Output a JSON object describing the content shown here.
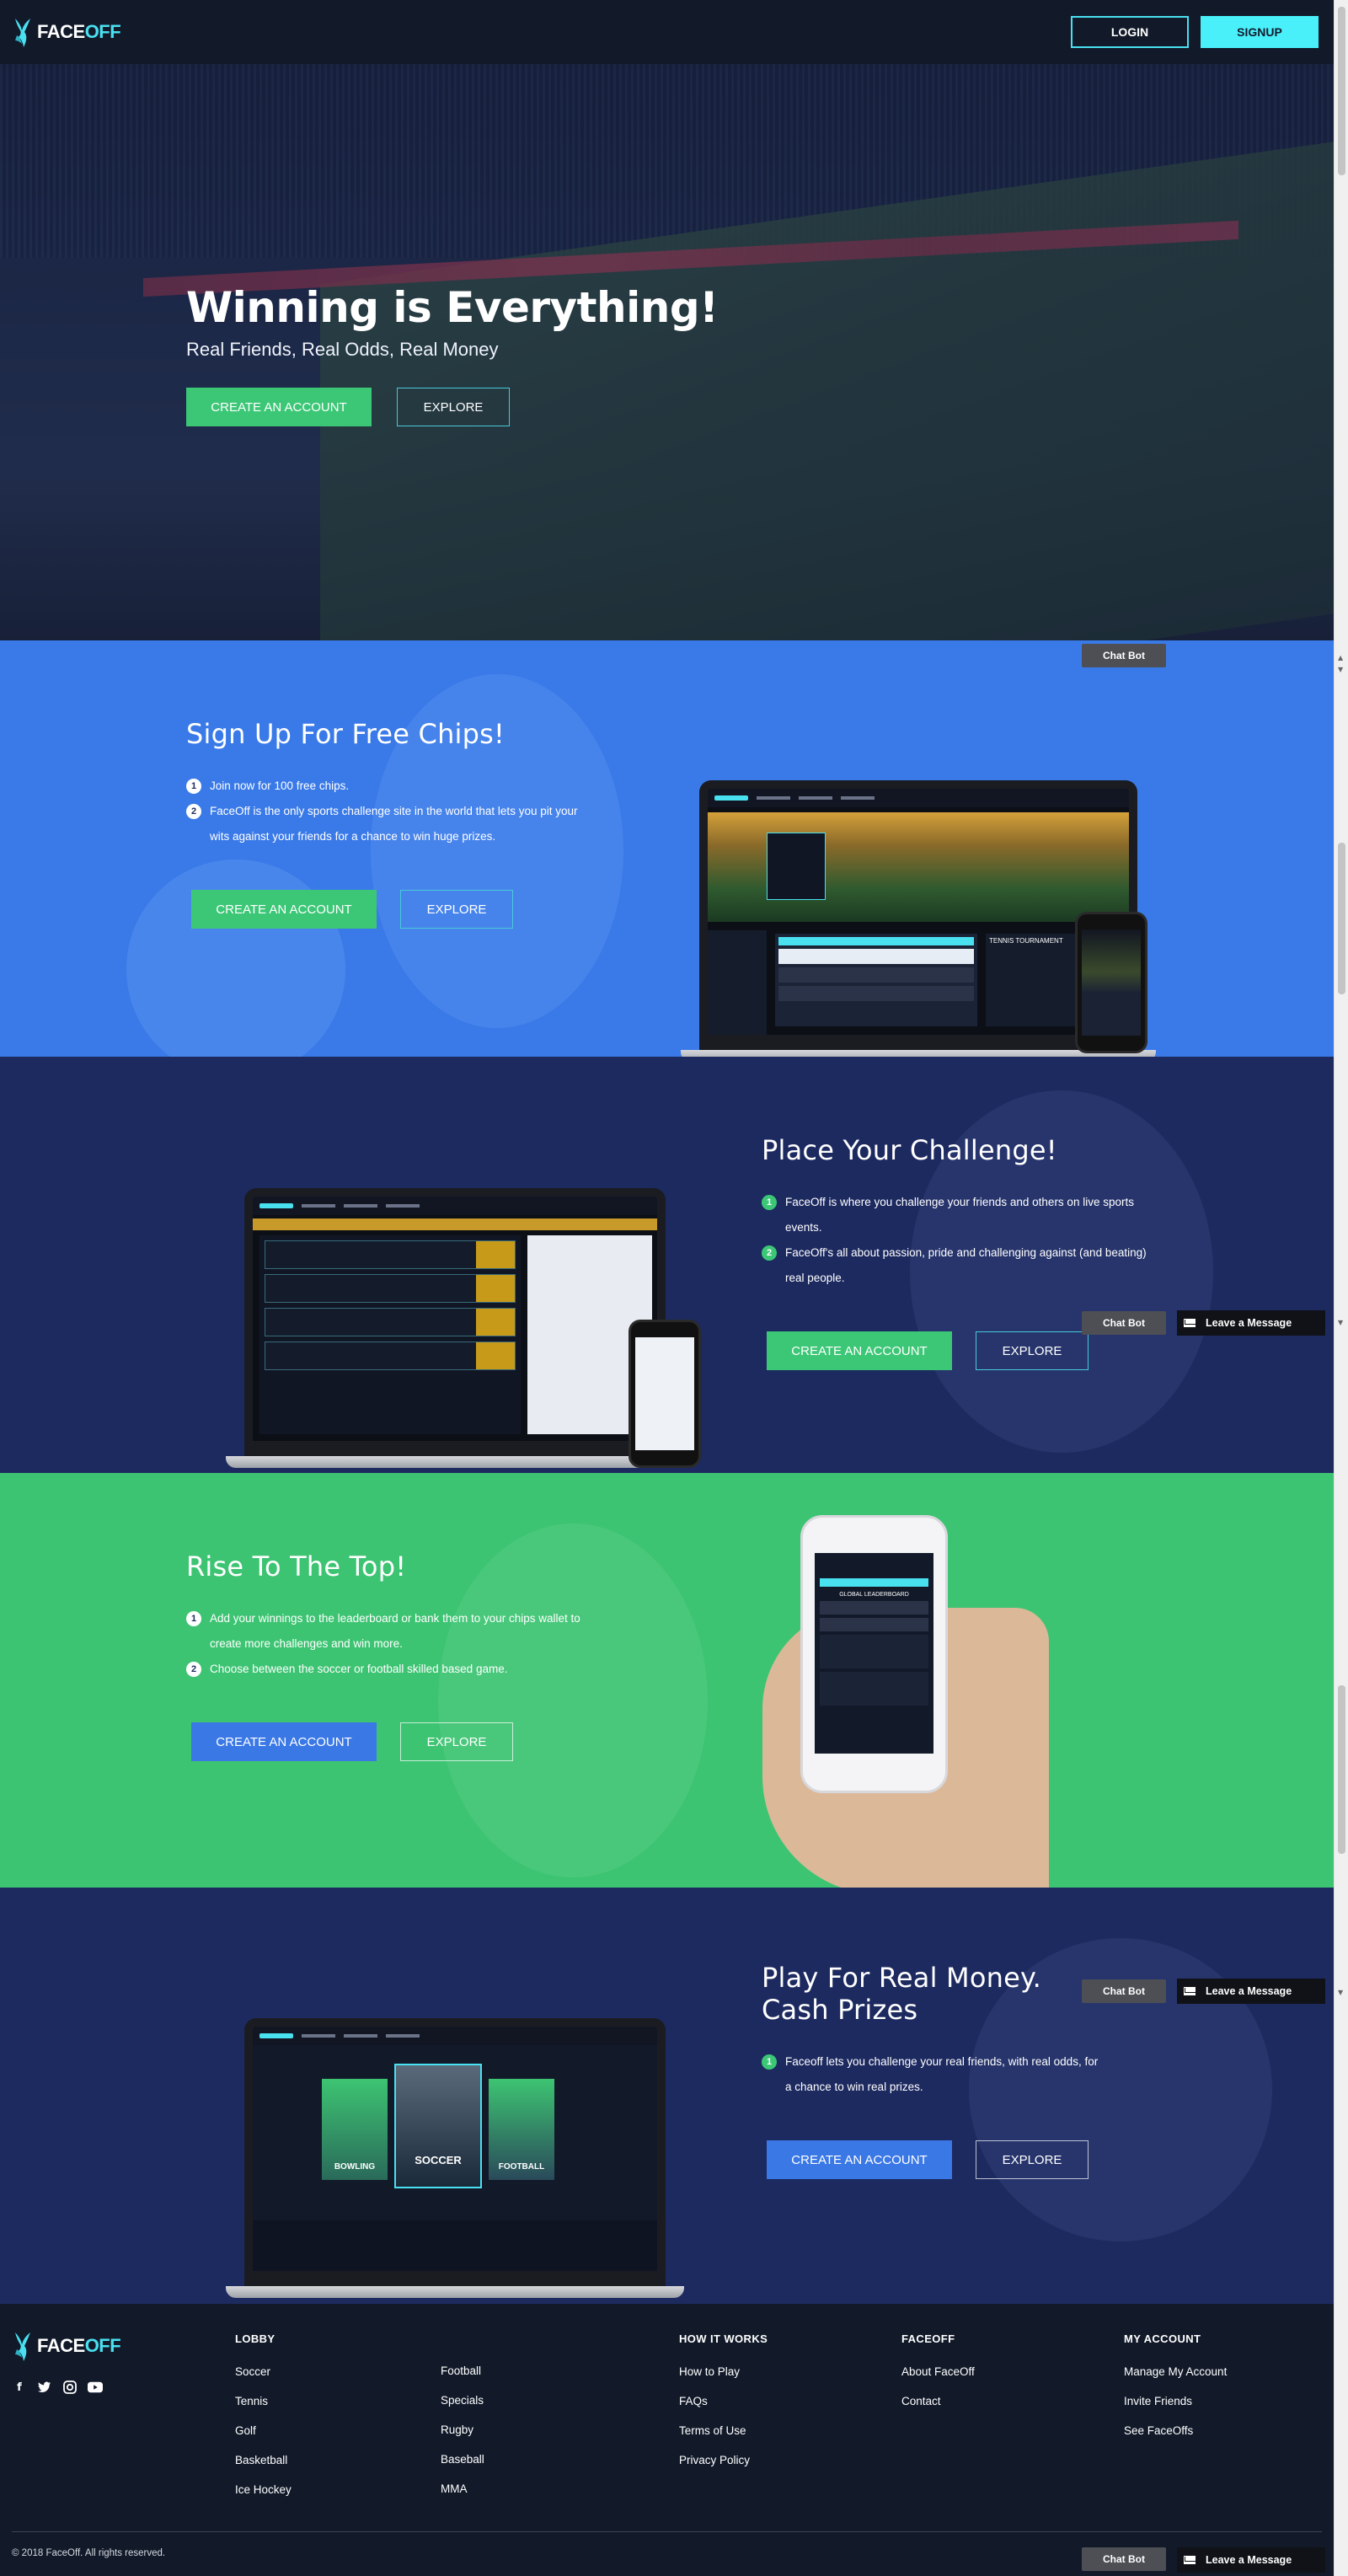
{
  "header": {
    "logo_face": "FACE",
    "logo_off": "OFF",
    "login_label": "LOGIN",
    "signup_label": "SIGNUP"
  },
  "hero": {
    "title": "Winning is Everything!",
    "subtitle": "Real Friends, Real Odds, Real Money",
    "create_label": "CREATE AN ACCOUNT",
    "explore_label": "EXPLORE"
  },
  "section_signup": {
    "title": "Sign Up For Free Chips!",
    "items": [
      {
        "num": "1",
        "text": "Join now for 100 free chips."
      },
      {
        "num": "2",
        "text": "FaceOff is the only sports challenge site in the world that lets you pit your wits against your friends for a chance to win huge prizes."
      }
    ],
    "create_label": "CREATE AN ACCOUNT",
    "explore_label": "EXPLORE"
  },
  "section_challenge": {
    "title": "Place Your Challenge!",
    "items": [
      {
        "num": "1",
        "text": "FaceOff is where you challenge your friends and others on live sports events."
      },
      {
        "num": "2",
        "text": "FaceOff's all about passion, pride and challenging against (and beating) real people."
      }
    ],
    "create_label": "CREATE AN ACCOUNT",
    "explore_label": "EXPLORE"
  },
  "section_top": {
    "title": "Rise To The Top!",
    "items": [
      {
        "num": "1",
        "text": "Add your winnings to the leaderboard or bank them to your chips wallet to create more challenges and win more."
      },
      {
        "num": "2",
        "text": "Choose between the soccer or football skilled based game."
      }
    ],
    "create_label": "CREATE AN ACCOUNT",
    "explore_label": "EXPLORE"
  },
  "section_money": {
    "title": "Play For Real Money. Cash Prizes",
    "items": [
      {
        "num": "1",
        "text": "Faceoff lets you challenge your real friends, with real odds, for a chance to win real prizes."
      }
    ],
    "create_label": "CREATE AN ACCOUNT",
    "explore_label": "EXPLORE",
    "screen_tiles": [
      "BOWLING",
      "SOCCER",
      "FOOTBALL"
    ]
  },
  "mockups": {
    "tournament_label": "TENNIS TOURNAMENT",
    "leaderboard_label": "GLOBAL LEADERBOARD"
  },
  "chat": {
    "chatbot_label": "Chat Bot",
    "leave_label": "Leave a Message"
  },
  "footer": {
    "logo_face": "FACE",
    "logo_off": "OFF",
    "lobby_head": "LOBBY",
    "lobby_col1": [
      "Soccer",
      "Tennis",
      "Golf",
      "Basketball",
      "Ice Hockey"
    ],
    "lobby_col2": [
      "Football",
      "Specials",
      "Rugby",
      "Baseball",
      "MMA"
    ],
    "how_head": "HOW IT WORKS",
    "how_links": [
      "How to Play",
      "FAQs",
      "Terms of Use",
      "Privacy Policy"
    ],
    "faceoff_head": "FACEOFF",
    "faceoff_links": [
      "About FaceOff",
      "Contact"
    ],
    "account_head": "MY ACCOUNT",
    "account_links": [
      "Manage My Account",
      "Invite Friends",
      "See FaceOffs"
    ],
    "social_icons": [
      "facebook-icon",
      "twitter-icon",
      "instagram-icon",
      "youtube-icon"
    ],
    "copyright": "© 2018 FaceOff. All rights reserved."
  },
  "colors": {
    "accent_cyan": "#49e0f0",
    "green": "#3cc776",
    "blue": "#3a7ae8",
    "navy": "#1d2a60",
    "dark": "#121a2a"
  }
}
